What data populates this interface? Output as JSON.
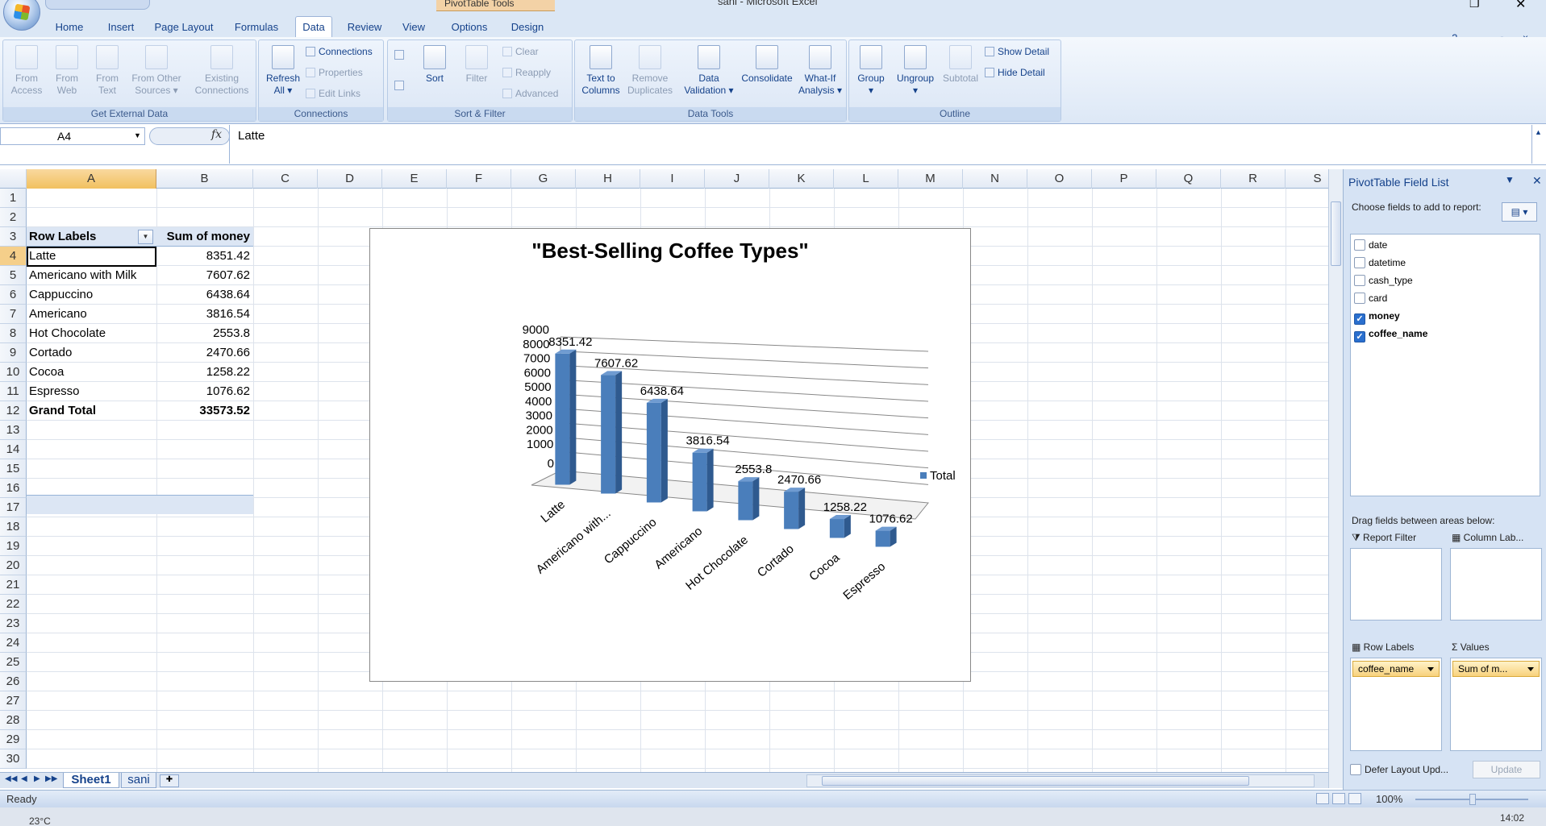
{
  "title_bar": {
    "window_title": "sani - Microsoft Excel",
    "contextual_tab_group": "PivotTable Tools"
  },
  "tabs": [
    "Home",
    "Insert",
    "Page Layout",
    "Formulas",
    "Data",
    "Review",
    "View",
    "Options",
    "Design"
  ],
  "active_tab": "Data",
  "ribbon": {
    "get_external_data": {
      "label": "Get External Data",
      "buttons": [
        {
          "line1": "From",
          "line2": "Access"
        },
        {
          "line1": "From",
          "line2": "Web"
        },
        {
          "line1": "From",
          "line2": "Text"
        },
        {
          "line1": "From Other",
          "line2": "Sources ▾"
        },
        {
          "line1": "Existing",
          "line2": "Connections"
        }
      ]
    },
    "connections": {
      "label": "Connections",
      "refresh": {
        "line1": "Refresh",
        "line2": "All ▾"
      },
      "items": [
        "Connections",
        "Properties",
        "Edit Links"
      ]
    },
    "sort_filter": {
      "label": "Sort & Filter",
      "sort": "Sort",
      "filter": "Filter",
      "items": [
        "Clear",
        "Reapply",
        "Advanced"
      ]
    },
    "data_tools": {
      "label": "Data Tools",
      "buttons": [
        {
          "line1": "Text to",
          "line2": "Columns"
        },
        {
          "line1": "Remove",
          "line2": "Duplicates"
        },
        {
          "line1": "Data",
          "line2": "Validation ▾"
        },
        {
          "line1": "Consolidate",
          "line2": ""
        },
        {
          "line1": "What-If",
          "line2": "Analysis ▾"
        }
      ]
    },
    "outline": {
      "label": "Outline",
      "buttons": [
        {
          "line1": "Group",
          "line2": "▾"
        },
        {
          "line1": "Ungroup",
          "line2": "▾"
        },
        {
          "line1": "Subtotal",
          "line2": ""
        }
      ],
      "items": [
        "Show Detail",
        "Hide Detail"
      ]
    }
  },
  "formula_bar": {
    "name_box": "A4",
    "fx": "fx",
    "formula": "Latte"
  },
  "grid": {
    "columns": [
      "A",
      "B",
      "C",
      "D",
      "E",
      "F",
      "G",
      "H",
      "I",
      "J",
      "K",
      "L",
      "M",
      "N",
      "O",
      "P",
      "Q",
      "R",
      "S"
    ],
    "rows": [
      "1",
      "2",
      "3",
      "4",
      "5",
      "6",
      "7",
      "8",
      "9",
      "10",
      "11",
      "12",
      "13",
      "14",
      "15",
      "16",
      "17",
      "18",
      "19",
      "20",
      "21",
      "22",
      "23",
      "24",
      "25",
      "26",
      "27",
      "28",
      "29",
      "30"
    ]
  },
  "pivot": {
    "header_label": "Row Labels",
    "header_value": "Sum of money",
    "rows": [
      {
        "label": "Latte",
        "value": "8351.42"
      },
      {
        "label": "Americano with Milk",
        "value": "7607.62"
      },
      {
        "label": "Cappuccino",
        "value": "6438.64"
      },
      {
        "label": "Americano",
        "value": "3816.54"
      },
      {
        "label": "Hot Chocolate",
        "value": "2553.8"
      },
      {
        "label": "Cortado",
        "value": "2470.66"
      },
      {
        "label": "Cocoa",
        "value": "1258.22"
      },
      {
        "label": "Espresso",
        "value": "1076.62"
      }
    ],
    "total_label": "Grand Total",
    "total_value": "33573.52"
  },
  "chart_data": {
    "type": "bar",
    "title": "\"Best-Selling Coffee Types\"",
    "categories": [
      "Latte",
      "Americano with...",
      "Cappuccino",
      "Americano",
      "Hot Chocolate",
      "Cortado",
      "Cocoa",
      "Espresso"
    ],
    "series": [
      {
        "name": "Total",
        "values": [
          8351.42,
          7607.62,
          6438.64,
          3816.54,
          2553.8,
          2470.66,
          1258.22,
          1076.62
        ]
      }
    ],
    "data_labels": [
      "8351.42",
      "7607.62",
      "6438.64",
      "3816.54",
      "2553.8",
      "2470.66",
      "1258.22",
      "1076.62"
    ],
    "y_ticks": [
      "0",
      "1000",
      "2000",
      "3000",
      "4000",
      "5000",
      "6000",
      "7000",
      "8000",
      "9000"
    ],
    "ylim": [
      0,
      9000
    ],
    "legend_position": "right",
    "grid": true,
    "bar_color": "#4a7ebb",
    "three_d": true
  },
  "sheet_tabs": [
    "Sheet1",
    "sani"
  ],
  "active_sheet": "Sheet1",
  "status": {
    "text": "Ready",
    "zoom": "100%"
  },
  "taskbar": {
    "weather": "23°C",
    "time": "14:02"
  },
  "field_list": {
    "title": "PivotTable Field List",
    "choose_label": "Choose fields to add to report:",
    "fields": [
      {
        "name": "date",
        "checked": false
      },
      {
        "name": "datetime",
        "checked": false
      },
      {
        "name": "cash_type",
        "checked": false
      },
      {
        "name": "card",
        "checked": false
      },
      {
        "name": "money",
        "checked": true
      },
      {
        "name": "coffee_name",
        "checked": true
      }
    ],
    "drag_label": "Drag fields between areas below:",
    "areas": {
      "report_filter": "Report Filter",
      "column_labels": "Column Lab...",
      "row_labels": "Row Labels",
      "values": "Values",
      "row_item": "coffee_name",
      "value_item": "Sum of m..."
    },
    "defer_label": "Defer Layout Upd...",
    "update_button": "Update"
  }
}
